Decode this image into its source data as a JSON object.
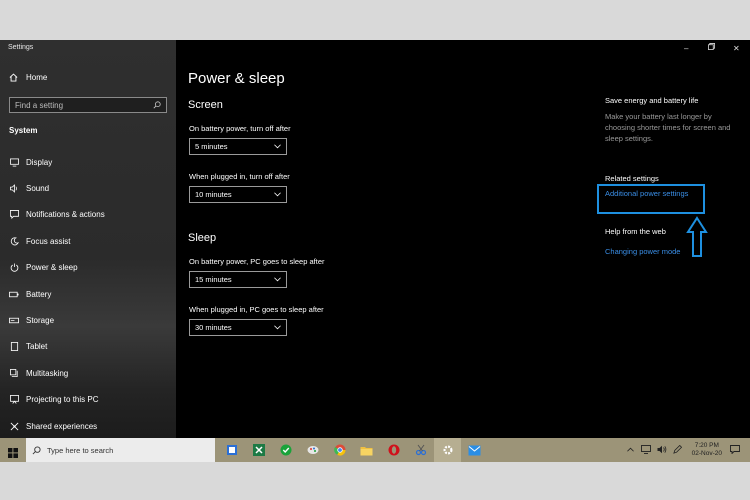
{
  "window": {
    "title": "Settings"
  },
  "sidebar": {
    "home_label": "Home",
    "search_placeholder": "Find a setting",
    "section_label": "System",
    "items": [
      {
        "label": "Display",
        "icon": "display-icon"
      },
      {
        "label": "Sound",
        "icon": "sound-icon"
      },
      {
        "label": "Notifications & actions",
        "icon": "notifications-icon"
      },
      {
        "label": "Focus assist",
        "icon": "focus-assist-icon"
      },
      {
        "label": "Power & sleep",
        "icon": "power-icon",
        "active": true
      },
      {
        "label": "Battery",
        "icon": "battery-icon"
      },
      {
        "label": "Storage",
        "icon": "storage-icon"
      },
      {
        "label": "Tablet",
        "icon": "tablet-icon"
      },
      {
        "label": "Multitasking",
        "icon": "multitasking-icon"
      },
      {
        "label": "Projecting to this PC",
        "icon": "projecting-icon"
      },
      {
        "label": "Shared experiences",
        "icon": "shared-experiences-icon"
      }
    ]
  },
  "main": {
    "title": "Power & sleep",
    "screen": {
      "heading": "Screen",
      "battery_label": "On battery power, turn off after",
      "battery_value": "5 minutes",
      "plugged_label": "When plugged in, turn off after",
      "plugged_value": "10 minutes"
    },
    "sleep": {
      "heading": "Sleep",
      "battery_label": "On battery power, PC goes to sleep after",
      "battery_value": "15 minutes",
      "plugged_label": "When plugged in, PC goes to sleep after",
      "plugged_value": "30 minutes"
    },
    "aside": {
      "save_title": "Save energy and battery life",
      "save_text": "Make your battery last longer by choosing shorter times for screen and sleep settings.",
      "related_title": "Related settings",
      "related_link": "Additional power settings",
      "help_title": "Help from the web",
      "help_link": "Changing power mode"
    }
  },
  "taskbar": {
    "search_placeholder": "Type here to search",
    "time": "7:20 PM",
    "date": "02-Nov-20"
  },
  "colors": {
    "accent": "#1e90e0",
    "link": "#3a8ee6",
    "taskbar": "#9c9478"
  }
}
